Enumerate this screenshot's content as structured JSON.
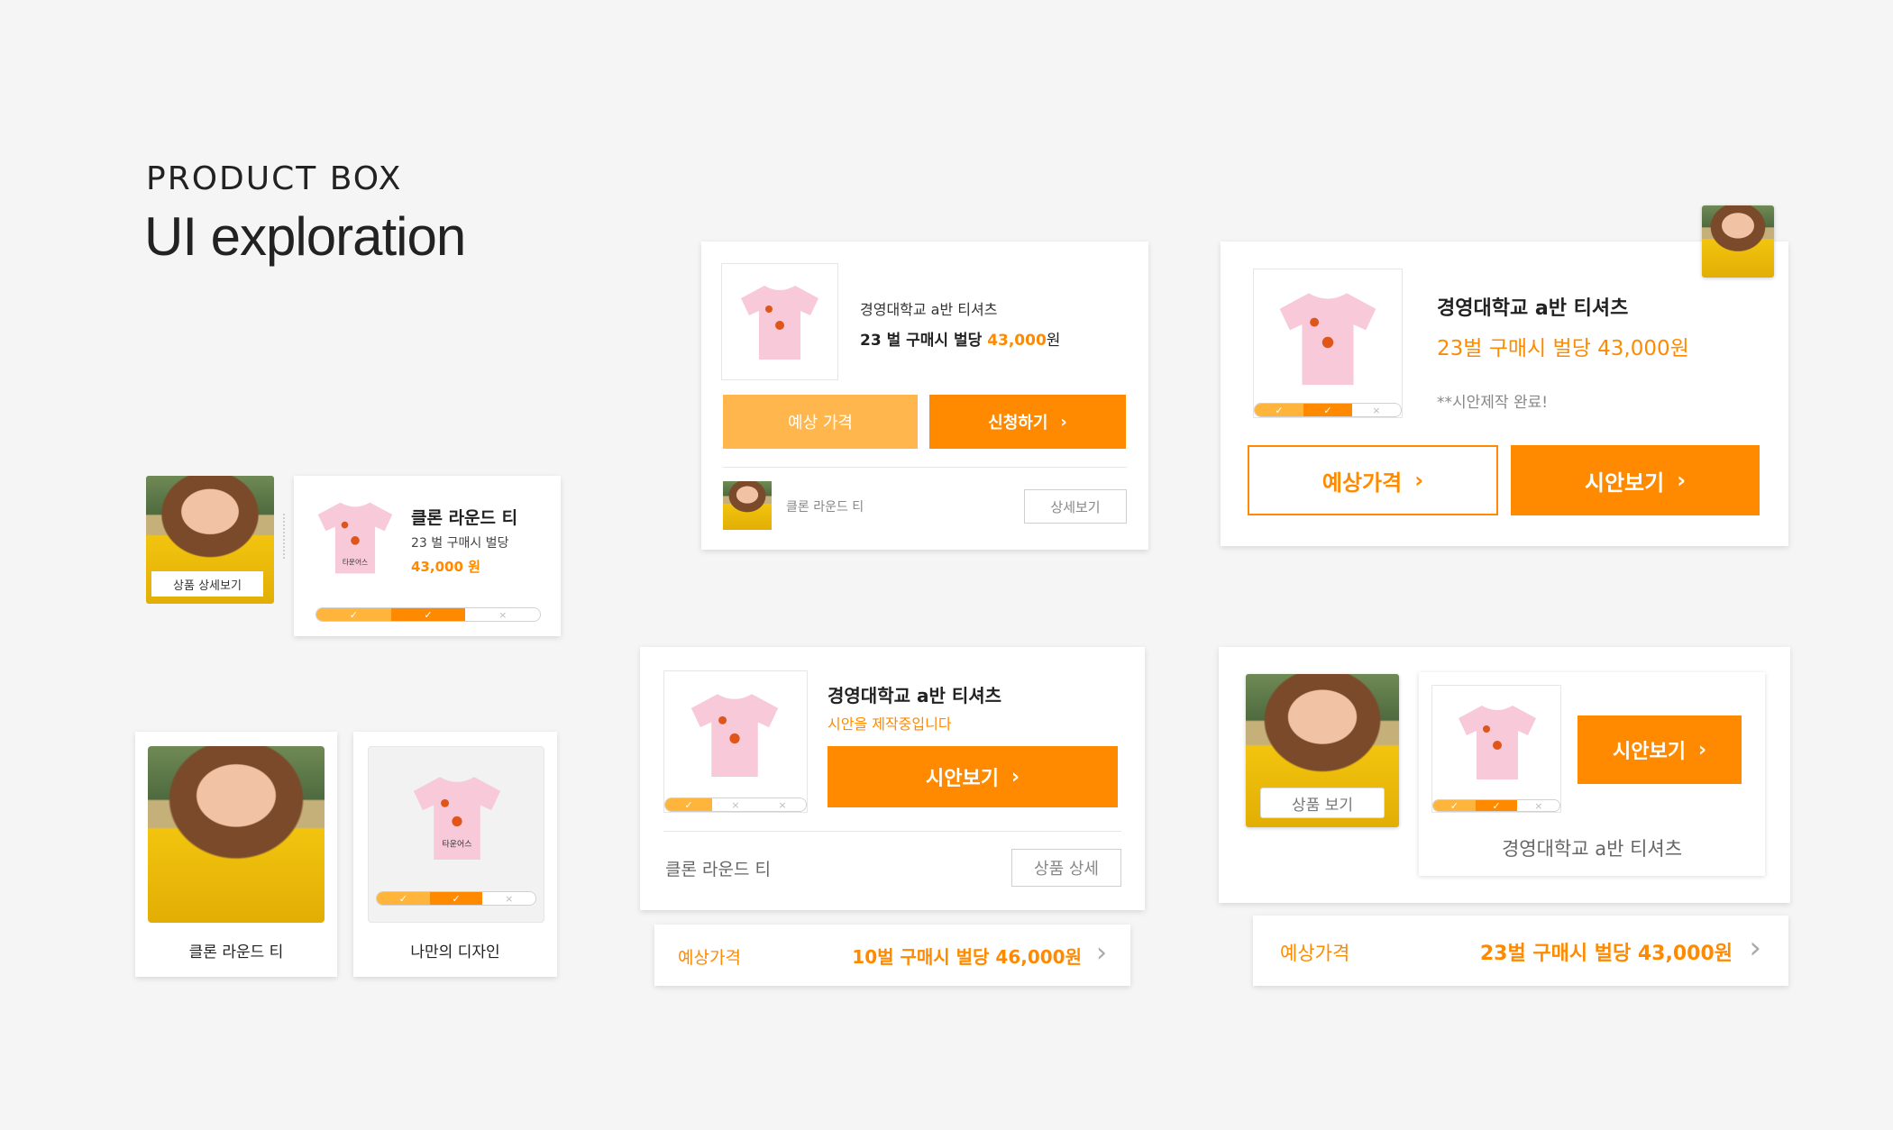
{
  "header": {
    "eyebrow": "PRODUCT BOX",
    "title": "UI exploration"
  },
  "colors": {
    "accent": "#ff8a00",
    "accent_light": "#ffb74d",
    "tee_pink": "#f7c9d9",
    "background": "#f5f5f5"
  },
  "progress_marks": {
    "done": "✓",
    "todo": "×"
  },
  "tee_print": "타운어스",
  "card_a": {
    "photo_button": "상품 상세보기",
    "name": "클론 라운드 티",
    "info": "23 벌 구매시 벌당",
    "price": "43,000 원"
  },
  "card_b": {
    "school": "경영대학교 a반 티셔츠",
    "line_prefix": "23 벌 구매시 벌당",
    "price_value": "43,000",
    "price_unit": "원",
    "btn_estimate": "예상 가격",
    "btn_apply": "신청하기",
    "footer_name": "클론 라운드 티",
    "footer_btn": "상세보기"
  },
  "card_c": {
    "school": "경영대학교 a반 티셔츠",
    "price_line": "23벌 구매시 벌당 43,000원",
    "note": "**시안제작 완료!",
    "btn_estimate": "예상가격",
    "btn_preview": "시안보기"
  },
  "tiles": {
    "photo_label": "클론 라운드 티",
    "design_label": "나만의 디자인"
  },
  "card_d": {
    "school": "경영대학교 a반 티셔츠",
    "status": "시안을 제작중입니다",
    "btn_preview": "시안보기",
    "footer_name": "클론 라운드 티",
    "footer_btn": "상품 상세",
    "strip_label": "예상가격",
    "strip_value": "10벌 구매시 벌당 46,000원"
  },
  "card_e": {
    "photo_button": "상품 보기",
    "btn_preview": "시안보기",
    "caption": "경영대학교 a반 티셔츠",
    "strip_label": "예상가격",
    "strip_value": "23벌 구매시 벌당 43,000원"
  },
  "progress": {
    "card_a": [
      1,
      1,
      0
    ],
    "card_c": [
      1,
      1,
      0
    ],
    "tile": [
      1,
      1,
      0
    ],
    "card_d": [
      1,
      0,
      0
    ],
    "card_e": [
      1,
      1,
      0
    ]
  }
}
